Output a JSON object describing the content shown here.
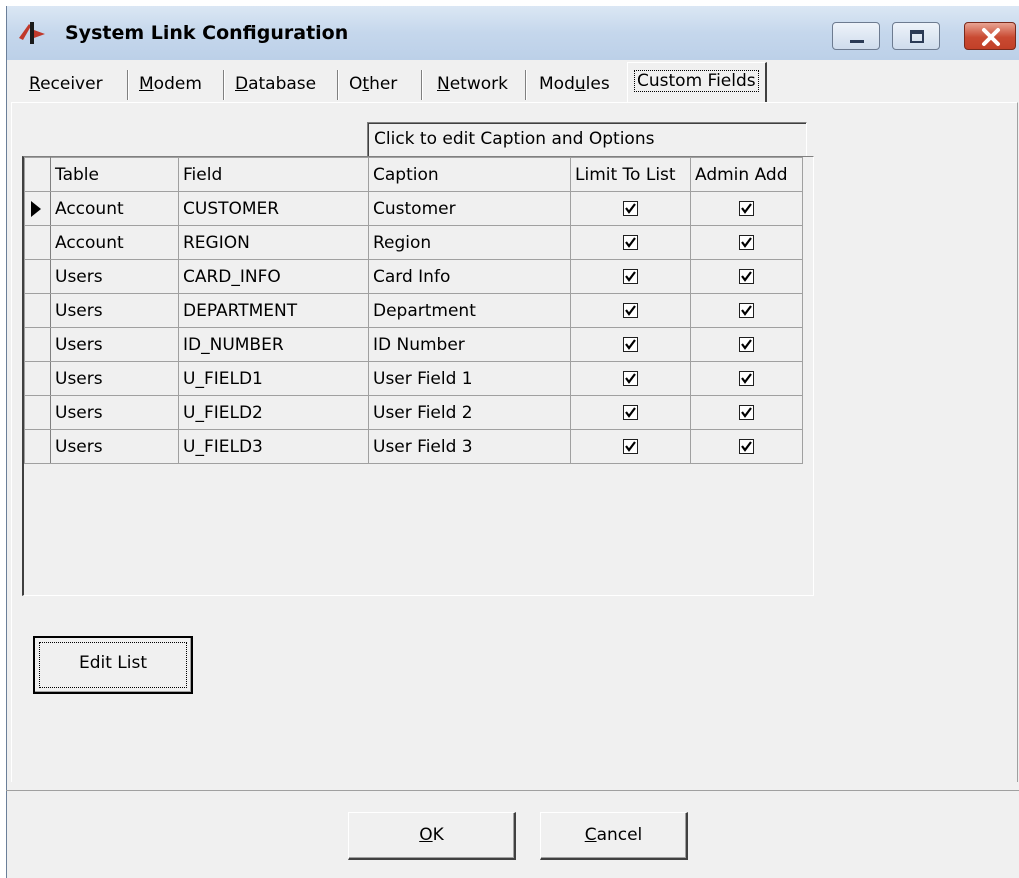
{
  "window": {
    "title": "System Link Configuration",
    "icon": "app-logo-icon"
  },
  "tabs": [
    {
      "label": "Receiver",
      "mnemonic": "R"
    },
    {
      "label": "Modem",
      "mnemonic": "M"
    },
    {
      "label": "Database",
      "mnemonic": "D"
    },
    {
      "label": "Other",
      "mnemonic": "t"
    },
    {
      "label": "Network",
      "mnemonic": "N"
    },
    {
      "label": "Modules",
      "mnemonic": "u"
    },
    {
      "label": "Custom Fields",
      "mnemonic": ""
    }
  ],
  "active_tab": "Custom Fields",
  "hint": "Click to edit Caption and Options",
  "grid": {
    "columns": [
      "Table",
      "Field",
      "Caption",
      "Limit To List",
      "Admin Add"
    ],
    "rows": [
      {
        "table": "Account",
        "field": "CUSTOMER",
        "caption": "Customer",
        "limit_to_list": true,
        "admin_add": true,
        "current": true
      },
      {
        "table": "Account",
        "field": "REGION",
        "caption": "Region",
        "limit_to_list": true,
        "admin_add": true
      },
      {
        "table": "Users",
        "field": "CARD_INFO",
        "caption": "Card Info",
        "limit_to_list": true,
        "admin_add": true
      },
      {
        "table": "Users",
        "field": "DEPARTMENT",
        "caption": "Department",
        "limit_to_list": true,
        "admin_add": true
      },
      {
        "table": "Users",
        "field": "ID_NUMBER",
        "caption": "ID Number",
        "limit_to_list": true,
        "admin_add": true
      },
      {
        "table": "Users",
        "field": "U_FIELD1",
        "caption": "User Field 1",
        "limit_to_list": true,
        "admin_add": true
      },
      {
        "table": "Users",
        "field": "U_FIELD2",
        "caption": "User Field 2",
        "limit_to_list": true,
        "admin_add": true
      },
      {
        "table": "Users",
        "field": "U_FIELD3",
        "caption": "User Field 3",
        "limit_to_list": true,
        "admin_add": true
      }
    ]
  },
  "buttons": {
    "edit_list": "Edit List",
    "ok": "OK",
    "cancel": "Cancel"
  },
  "colors": {
    "titlebar": "#c5d7ec",
    "face": "#f0f0f0",
    "close": "#c94a32"
  }
}
